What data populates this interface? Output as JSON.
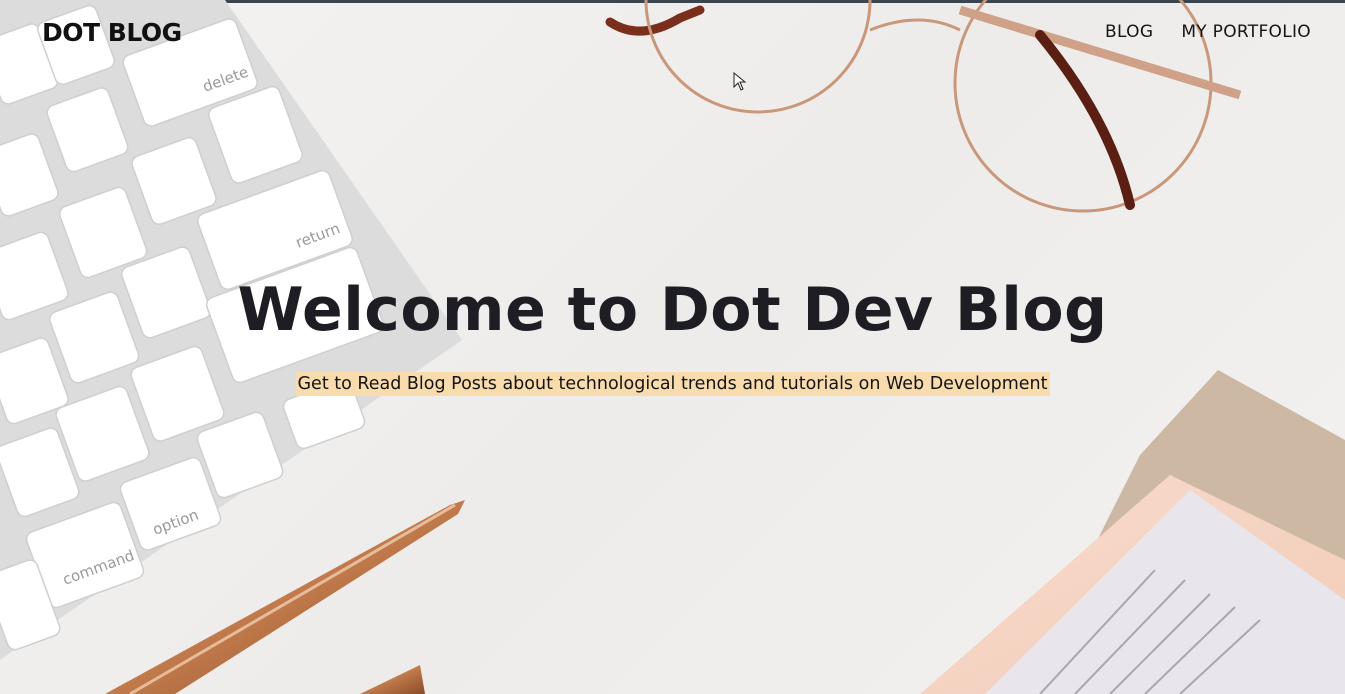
{
  "header": {
    "brand": "DOT BLOG",
    "nav": [
      {
        "label": "BLOG"
      },
      {
        "label": "MY PORTFOLIO"
      }
    ]
  },
  "hero": {
    "title": "Welcome to Dot Dev Blog",
    "subtitle": "Get to Read Blog Posts about technological trends and tutorials on Web Development",
    "subtitle_highlight_color": "#f9dcae"
  },
  "keyboard_keys": [
    "delete",
    "return",
    "option",
    "command"
  ],
  "icons": [
    "mouse-pointer-icon"
  ]
}
